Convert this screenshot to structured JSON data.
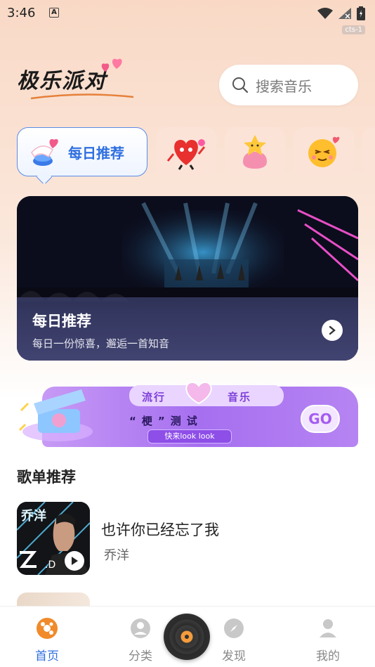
{
  "status_bar": {
    "time": "3:46",
    "notif_letter": "A",
    "tag": "cts-1"
  },
  "app": {
    "logo_text": "极乐派对"
  },
  "search": {
    "placeholder": "搜索音乐"
  },
  "categories": [
    {
      "label": "每日推荐",
      "icon": "megaphone-heart-icon",
      "active": true
    },
    {
      "label": "",
      "icon": "heart-character-icon"
    },
    {
      "label": "",
      "icon": "star-bag-icon"
    },
    {
      "label": "",
      "icon": "love-emoji-icon"
    }
  ],
  "banner": {
    "title": "每日推荐",
    "subtitle": "每日一份惊喜，邂逅一首知音"
  },
  "promo": {
    "tag1": "流行",
    "tag2": "音乐",
    "middle": "“梗”测试",
    "pill": "快来look look",
    "go": "GO"
  },
  "playlist_section": {
    "title": "歌单推荐",
    "items": [
      {
        "title": "也许你已经忘了我",
        "artist": "乔洋",
        "cover_text": "乔洋"
      }
    ]
  },
  "tabbar": {
    "tabs": [
      {
        "label": "首页",
        "icon": "vinyl-icon",
        "active": true
      },
      {
        "label": "分类",
        "icon": "user-circle-icon"
      },
      {
        "label": "发现",
        "icon": "compass-icon"
      },
      {
        "label": "我的",
        "icon": "person-icon"
      }
    ],
    "center_icon": "record-disc-icon"
  },
  "colors": {
    "accent": "#2f6fe0",
    "promo": "#a66ff0",
    "bg_top": "#f9d9c6"
  }
}
